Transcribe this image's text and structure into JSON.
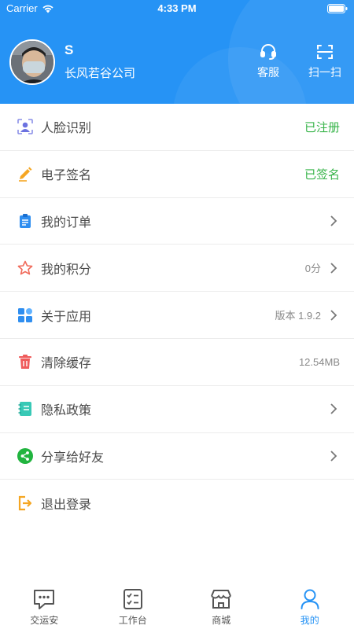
{
  "status_bar": {
    "carrier": "Carrier",
    "time": "4:33 PM"
  },
  "profile": {
    "name": "S",
    "company": "长风若谷公司"
  },
  "actions": {
    "service": "客服",
    "scan": "扫一扫"
  },
  "menu": [
    {
      "label": "人脸识别",
      "value": "已注册",
      "icon": "face-id-icon"
    },
    {
      "label": "电子签名",
      "value": "已签名",
      "icon": "pen-icon"
    },
    {
      "label": "我的订单",
      "value": "",
      "icon": "clipboard-icon"
    },
    {
      "label": "我的积分",
      "value": "0分",
      "icon": "star-icon"
    },
    {
      "label": "关于应用",
      "value": "版本 1.9.2",
      "icon": "apps-icon"
    },
    {
      "label": "清除缓存",
      "value": "12.54MB",
      "icon": "trash-icon"
    },
    {
      "label": "隐私政策",
      "value": "",
      "icon": "notebook-icon"
    },
    {
      "label": "分享给好友",
      "value": "",
      "icon": "share-icon"
    },
    {
      "label": "退出登录",
      "value": "",
      "icon": "logout-icon"
    }
  ],
  "tabs": [
    {
      "label": "交运安",
      "icon": "chat-icon"
    },
    {
      "label": "工作台",
      "icon": "checklist-icon"
    },
    {
      "label": "商城",
      "icon": "store-icon"
    },
    {
      "label": "我的",
      "icon": "user-icon",
      "active": true
    }
  ],
  "colors": {
    "primary": "#2693f5",
    "status_green": "#38b44a"
  }
}
